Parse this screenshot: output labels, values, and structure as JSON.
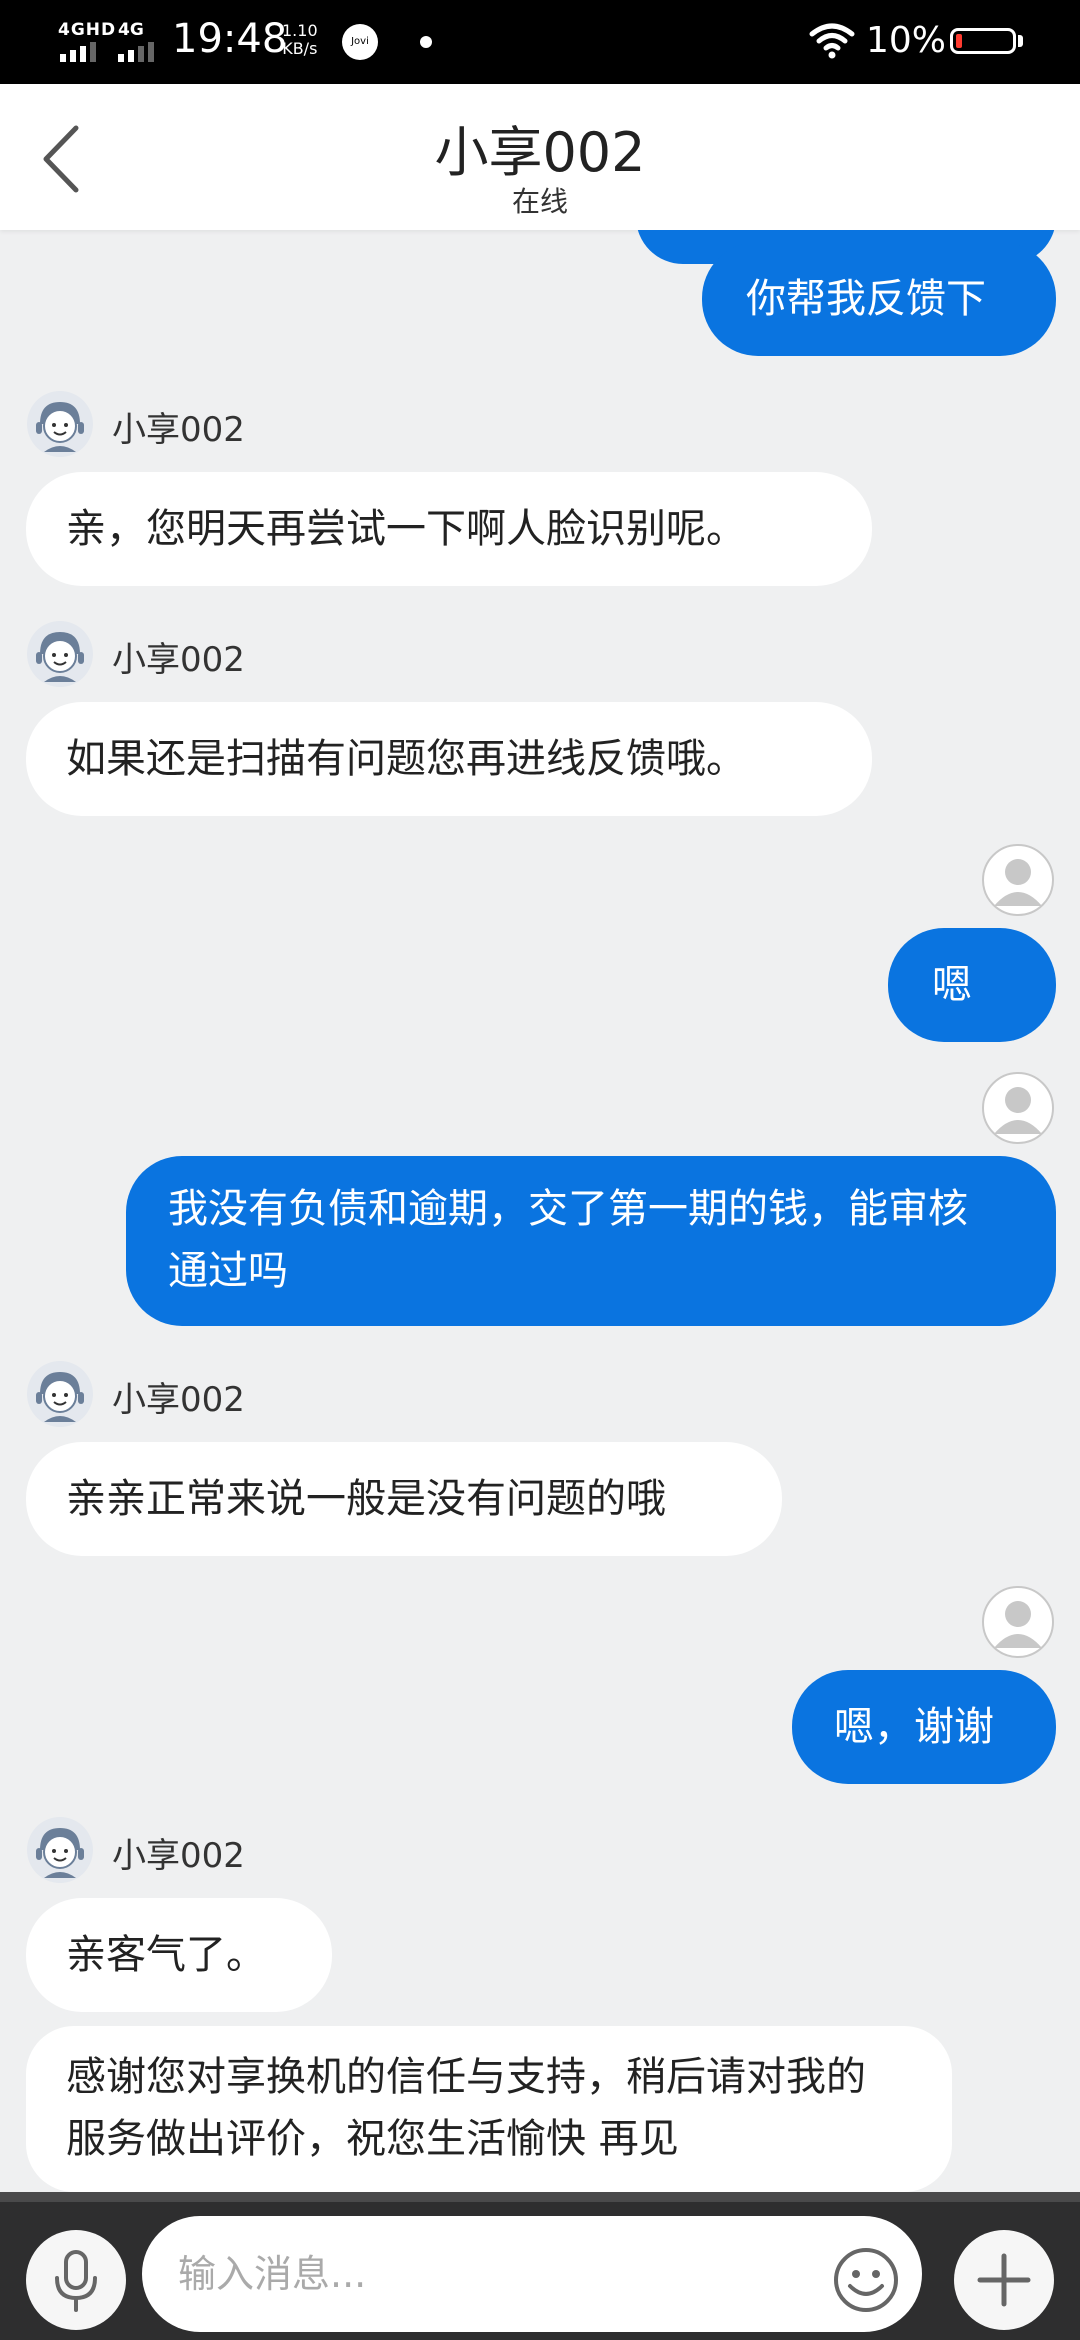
{
  "status_bar": {
    "network1": "4GHD",
    "network2": "4G",
    "time": "19:48",
    "speed_value": "1.10",
    "speed_unit": "KB/s",
    "jovi_label": "Jovi",
    "battery_pct": "10%",
    "battery_level": 0.1,
    "battery_color": "#ff3b30"
  },
  "header": {
    "title": "小享002",
    "subtitle": "在线"
  },
  "agent_name": "小享002",
  "messages": [
    {
      "side": "out",
      "text": "你帮我反馈下"
    },
    {
      "side": "in",
      "sender": "小享002",
      "text": "亲，您明天再尝试一下啊人脸识别呢。"
    },
    {
      "side": "in",
      "sender": "小享002",
      "text": "如果还是扫描有问题您再进线反馈哦。"
    },
    {
      "side": "out",
      "text": "嗯"
    },
    {
      "side": "out",
      "text": "我没有负债和逾期，交了第一期的钱，能审核通过吗"
    },
    {
      "side": "in",
      "sender": "小享002",
      "text": "亲亲正常来说一般是没有问题的哦"
    },
    {
      "side": "out",
      "text": "嗯，谢谢"
    },
    {
      "side": "in",
      "sender": "小享002",
      "text": "亲客气了。"
    },
    {
      "side": "in",
      "text": "感谢您对享换机的信任与支持，稍后请对我的服务做出评价，祝您生活愉快  再见"
    }
  ],
  "input": {
    "placeholder": "输入消息..."
  },
  "colors": {
    "outgoing_bubble": "#0a74e0",
    "incoming_bubble": "#ffffff",
    "chat_background": "#eff0f1"
  }
}
